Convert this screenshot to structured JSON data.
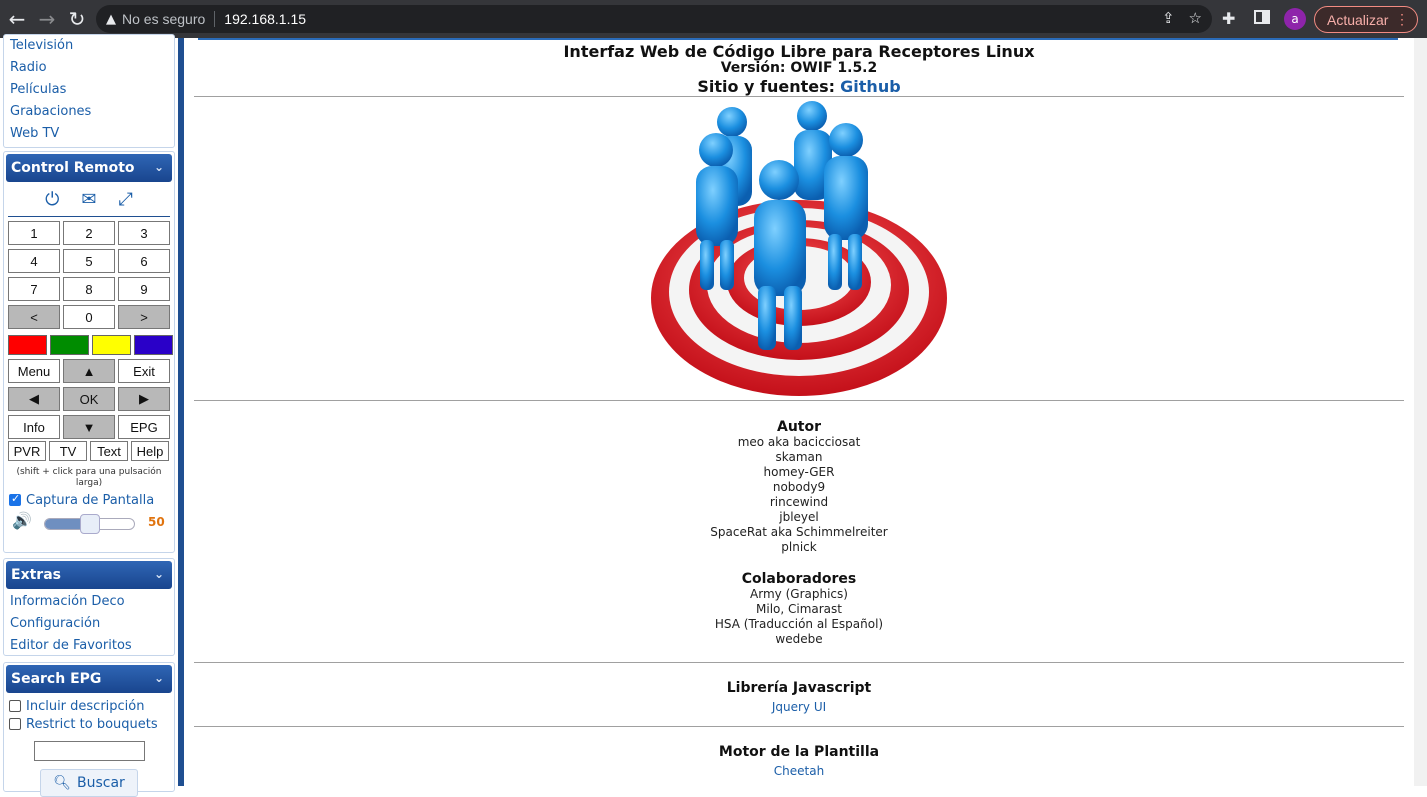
{
  "browser": {
    "security_label": "No es seguro",
    "url": "192.168.1.15",
    "avatar_letter": "a",
    "update_label": "Actualizar"
  },
  "sidebar": {
    "media_links": [
      "Televisión",
      "Radio",
      "Películas",
      "Grabaciones",
      "Web TV"
    ],
    "remote": {
      "title": "Control Remoto",
      "numpad": [
        "1",
        "2",
        "3",
        "4",
        "5",
        "6",
        "7",
        "8",
        "9",
        "<",
        "0",
        ">"
      ],
      "colors": [
        "#ff0000",
        "#008c00",
        "#ffff00",
        "#2a00c8"
      ],
      "menu_label": "Menu",
      "up_label": "▲",
      "exit_label": "Exit",
      "left_label": "◀",
      "ok_label": "OK",
      "right_label": "▶",
      "info_label": "Info",
      "down_label": "▼",
      "epg_label": "EPG",
      "bottom_row": [
        "PVR",
        "TV",
        "Text",
        "Help"
      ],
      "hint": "(shift + click para una pulsación larga)",
      "screenshot_label": "Captura de Pantalla",
      "volume": 50,
      "volume_label": "50"
    },
    "extras": {
      "title": "Extras",
      "links": [
        "Información Deco",
        "Configuración",
        "Editor de Favoritos"
      ]
    },
    "search": {
      "title": "Search EPG",
      "include_desc_label": "Incluir descripción",
      "restrict_label": "Restrict to bouquets",
      "button_label": "Buscar"
    }
  },
  "main": {
    "title": "Interfaz Web de Código Libre para Receptores Linux",
    "version": "Versión: OWIF 1.5.2",
    "site_prefix": "Sitio y fuentes:",
    "site_link": "Github",
    "authors_title": "Autor",
    "authors": [
      "meo aka bacicciosat",
      "skaman",
      "homey-GER",
      "nobody9",
      "rincewind",
      "jbleyel",
      "SpaceRat aka Schimmelreiter",
      "plnick"
    ],
    "collab_title": "Colaboradores",
    "collaborators": [
      "Army (Graphics)",
      "Milo, Cimarast",
      "HSA (Traducción al Español)",
      "wedebe"
    ],
    "js_title": "Librería Javascript",
    "js_link": "Jquery UI",
    "tpl_title": "Motor de la Plantilla",
    "tpl_link": "Cheetah"
  }
}
